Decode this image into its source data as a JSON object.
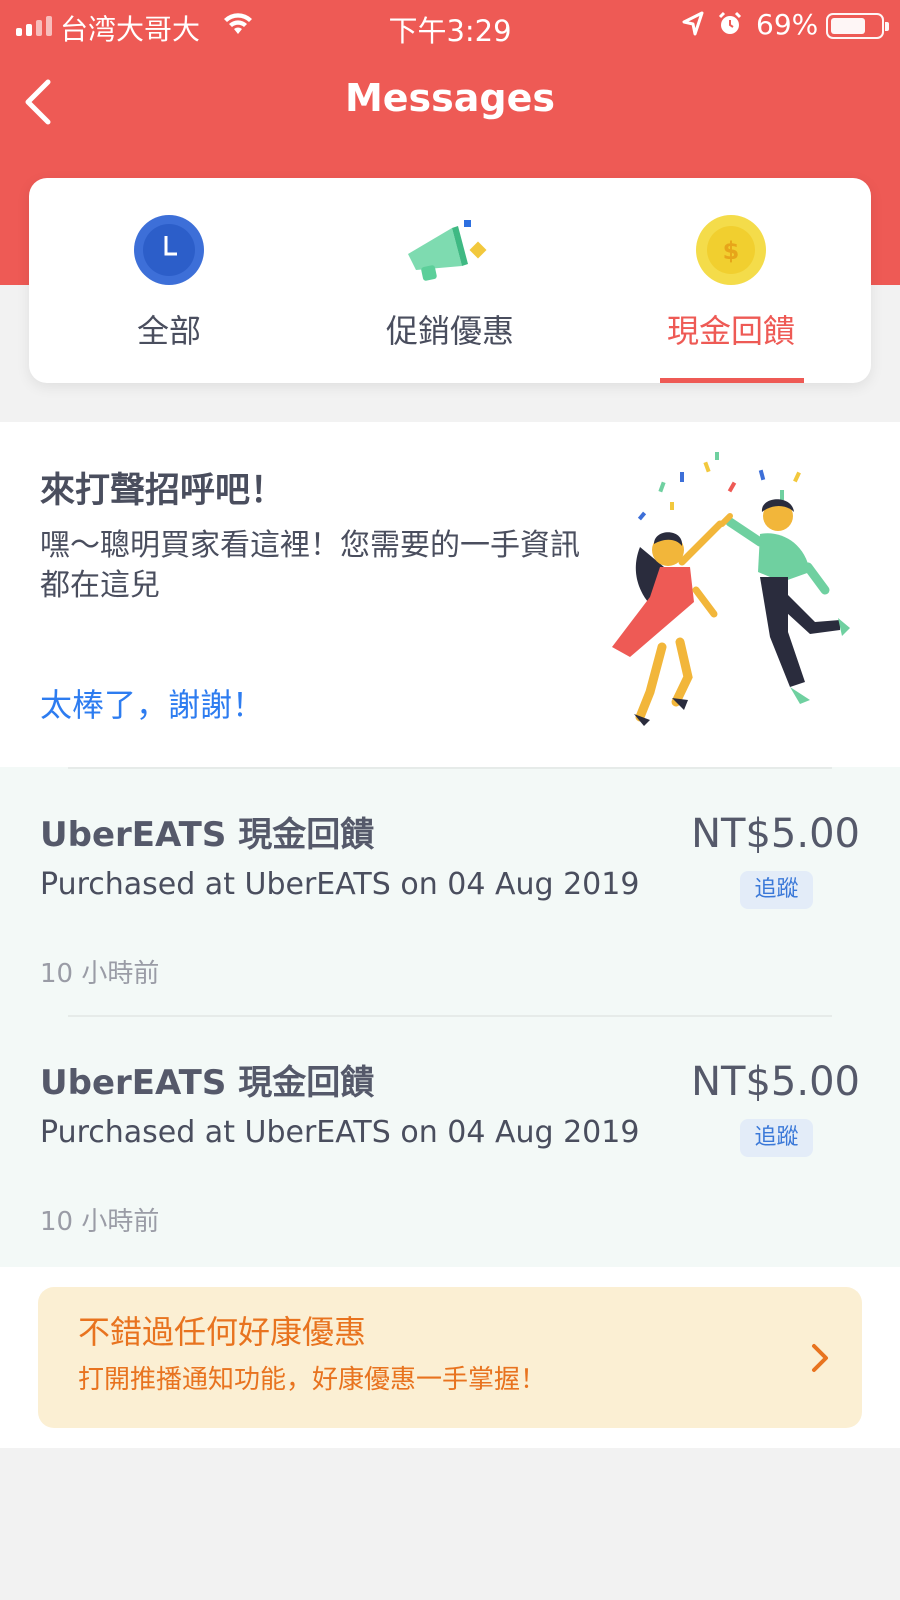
{
  "status_bar": {
    "carrier": "台湾大哥大",
    "time": "下午3:29",
    "battery": "69%"
  },
  "nav": {
    "title": "Messages"
  },
  "tabs": [
    {
      "label": "全部",
      "icon": "clock-icon",
      "active": false
    },
    {
      "label": "促銷優惠",
      "icon": "megaphone-icon",
      "active": false
    },
    {
      "label": "現金回饋",
      "icon": "dollar-coin-icon",
      "active": true
    }
  ],
  "intro": {
    "title": "來打聲招呼吧！",
    "body": "嘿～聰明買家看這裡！您需要的一手資訊都在這兒",
    "action": "太棒了，謝謝！"
  },
  "messages": [
    {
      "title": "UberEATS 現金回饋",
      "description": "Purchased at UberEATS on 04 Aug 2019",
      "amount": "NT$5.00",
      "track_label": "追蹤",
      "time": "10 小時前"
    },
    {
      "title": "UberEATS 現金回饋",
      "description": "Purchased at UberEATS on 04 Aug 2019",
      "amount": "NT$5.00",
      "track_label": "追蹤",
      "time": "10 小時前"
    }
  ],
  "banner": {
    "title": "不錯過任何好康優惠",
    "subtitle": "打開推播通知功能，好康優惠一手掌握！"
  },
  "colors": {
    "brand_red": "#ee5a55",
    "link_blue": "#2d7cf0",
    "banner_orange": "#e8731f",
    "banner_bg": "#fbefd3"
  }
}
